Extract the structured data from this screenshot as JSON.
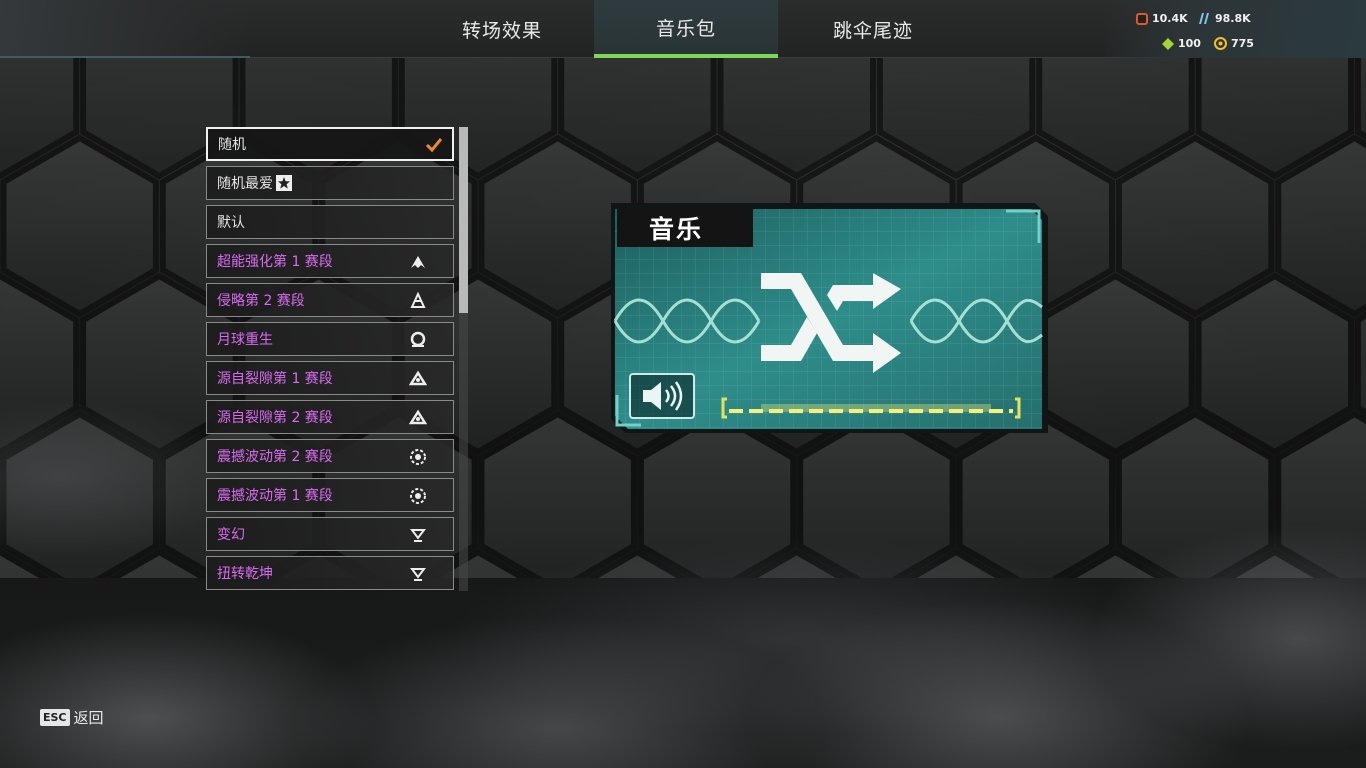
{
  "tabs": [
    {
      "label": "转场效果",
      "active": false
    },
    {
      "label": "音乐包",
      "active": true
    },
    {
      "label": "跳伞尾迹",
      "active": false
    }
  ],
  "currency": {
    "legend_tokens": "10.4K",
    "crafting": "98.8K",
    "heirloom_shards": "100",
    "apex_coins": "775"
  },
  "list": {
    "items": [
      {
        "label": "随机",
        "selected": true,
        "icon": "checkmark-icon"
      },
      {
        "label": "随机最爱",
        "selected": false,
        "icon": "favorite-star-icon"
      },
      {
        "label": "默认",
        "selected": false,
        "icon": ""
      },
      {
        "label": "超能强化第 1 赛段",
        "selected": false,
        "icon": "season-emblem-icon"
      },
      {
        "label": "侵略第 2 赛段",
        "selected": false,
        "icon": "season-emblem-icon"
      },
      {
        "label": "月球重生",
        "selected": false,
        "icon": "season-emblem-icon"
      },
      {
        "label": "源自裂隙第 1 赛段",
        "selected": false,
        "icon": "season-emblem-icon"
      },
      {
        "label": "源自裂隙第 2 赛段",
        "selected": false,
        "icon": "season-emblem-icon"
      },
      {
        "label": "震撼波动第 2 赛段",
        "selected": false,
        "icon": "season-emblem-icon"
      },
      {
        "label": "震撼波动第 1 赛段",
        "selected": false,
        "icon": "season-emblem-icon"
      },
      {
        "label": "变幻",
        "selected": false,
        "icon": "season-emblem-icon"
      },
      {
        "label": "扭转乾坤",
        "selected": false,
        "icon": "season-emblem-icon"
      }
    ]
  },
  "preview": {
    "title": "音乐",
    "icon": "shuffle-icon",
    "speaker_icon": "speaker-icon"
  },
  "footer": {
    "esc_key": "ESC",
    "back_label": "返回"
  },
  "colors": {
    "active_tab_underline": "#7ed957",
    "rare_item_text": "#d86bf0",
    "checkmark": "#f08a24",
    "volume_bar": "#f5f07a",
    "preview_bg": "#2e8d8a"
  }
}
